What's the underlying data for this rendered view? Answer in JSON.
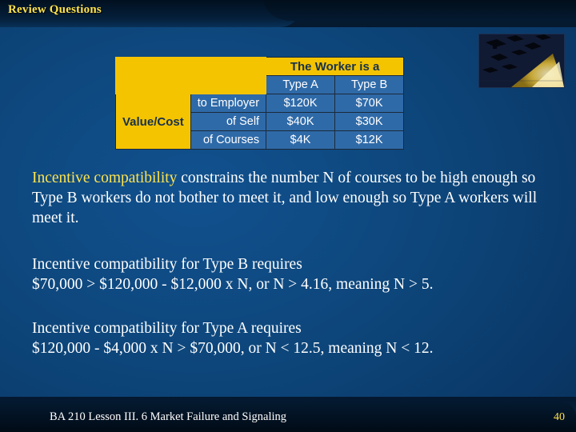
{
  "slide": {
    "title": "Review Questions",
    "accent_color": "#ffe34d",
    "background_color": "#0a3b6e"
  },
  "table": {
    "header": "The Worker is a",
    "columns": [
      "Type A",
      "Type B"
    ],
    "row_group_label": "Value/Cost",
    "rows": [
      {
        "label": "to Employer",
        "values": [
          "$120K",
          "$70K"
        ]
      },
      {
        "label": "of Self",
        "values": [
          "$40K",
          "$30K"
        ]
      },
      {
        "label": "of Courses",
        "values": [
          "$4K",
          "$12K"
        ]
      }
    ],
    "header_bg": "#f5c400",
    "cell_bg": "#2f6aa8"
  },
  "paragraphs": {
    "p1_highlight": "Incentive compatibility",
    "p1_rest": " constrains the number N of courses to be high enough so Type B workers do not bother to meet it, and low enough so Type A workers will meet it.",
    "p2_line1": "Incentive compatibility for Type B requires",
    "p2_line2": "$70,000 > $120,000 - $12,000 x N, or N > 4.16, meaning N > 5.",
    "p3_line1": "Incentive compatibility for Type A requires",
    "p3_line2": "$120,000 - $4,000 x N > $70,000, or N < 12.5, meaning N < 12."
  },
  "footer": {
    "text": "BA 210  Lesson III. 6 Market Failure and Signaling",
    "page_number": "40"
  },
  "image": {
    "name": "graduation-caps-photo"
  }
}
